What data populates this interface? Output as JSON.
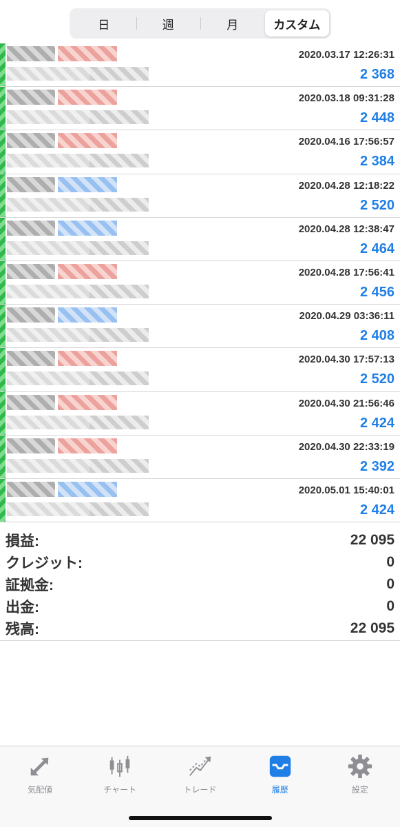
{
  "segments": [
    {
      "label": "日"
    },
    {
      "label": "週"
    },
    {
      "label": "月"
    },
    {
      "label": "カスタム",
      "active": true
    }
  ],
  "deals": [
    {
      "date": "2020.03.17 12:26:31",
      "profit": "2 368",
      "tag": "red"
    },
    {
      "date": "2020.03.18 09:31:28",
      "profit": "2 448",
      "tag": "red"
    },
    {
      "date": "2020.04.16 17:56:57",
      "profit": "2 384",
      "tag": "red"
    },
    {
      "date": "2020.04.28 12:18:22",
      "profit": "2 520",
      "tag": "blue"
    },
    {
      "date": "2020.04.28 12:38:47",
      "profit": "2 464",
      "tag": "blue"
    },
    {
      "date": "2020.04.28 17:56:41",
      "profit": "2 456",
      "tag": "red"
    },
    {
      "date": "2020.04.29 03:36:11",
      "profit": "2 408",
      "tag": "blue"
    },
    {
      "date": "2020.04.30 17:57:13",
      "profit": "2 520",
      "tag": "red"
    },
    {
      "date": "2020.04.30 21:56:46",
      "profit": "2 424",
      "tag": "red"
    },
    {
      "date": "2020.04.30 22:33:19",
      "profit": "2 392",
      "tag": "red"
    },
    {
      "date": "2020.05.01 15:40:01",
      "profit": "2 424",
      "tag": "blue"
    }
  ],
  "summary": [
    {
      "label": "損益:",
      "value": "22 095"
    },
    {
      "label": "クレジット:",
      "value": "0"
    },
    {
      "label": "証拠金:",
      "value": "0"
    },
    {
      "label": "出金:",
      "value": "0"
    },
    {
      "label": "残高:",
      "value": "22 095"
    }
  ],
  "tabs": [
    {
      "label": "気配値",
      "icon": "quotes-arrows-icon"
    },
    {
      "label": "チャート",
      "icon": "candlestick-icon"
    },
    {
      "label": "トレード",
      "icon": "trend-lines-icon"
    },
    {
      "label": "履歴",
      "icon": "inbox-tray-icon",
      "active": true
    },
    {
      "label": "設定",
      "icon": "gear-icon"
    }
  ],
  "colors": {
    "accent": "#1f7fe6",
    "profit": "#1f7fe6",
    "buy_stripe": "#2fb84c",
    "sell_tag": "#e88b84",
    "buy_tag": "#7fb1ec"
  }
}
